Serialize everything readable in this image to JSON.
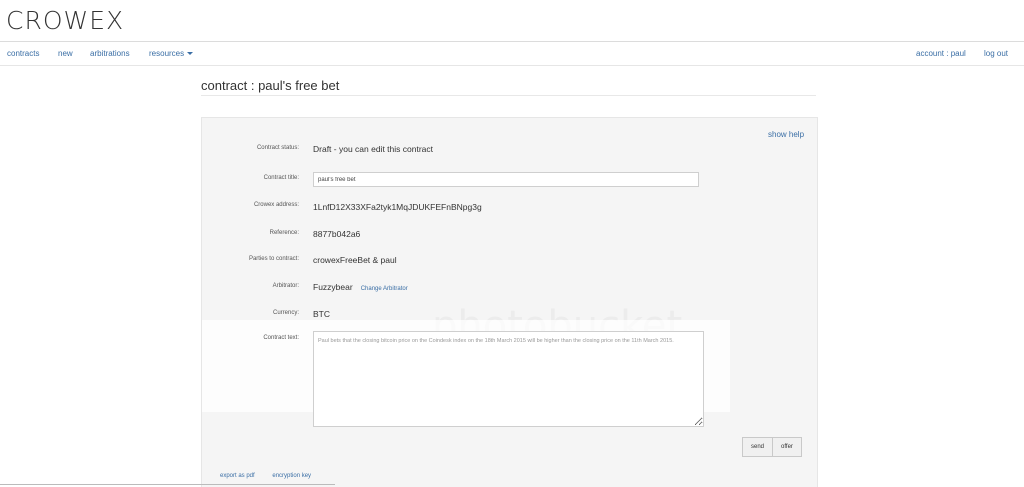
{
  "brand": "CROWEX",
  "nav": {
    "left": [
      "contracts",
      "new",
      "arbitrations",
      "resources"
    ],
    "account": "account : paul",
    "logout": "log out"
  },
  "page_title": "contract : paul's free bet",
  "help_link": "show help",
  "fields": {
    "status_label": "Contract status:",
    "status_value": "Draft - you can edit this contract",
    "title_label": "Contract title:",
    "title_value": "paul's free bet",
    "address_label": "Crowex address:",
    "address_value": "1LnfD12X33XFa2tyk1MqJDUKFEFnBNpg3g",
    "reference_label": "Reference:",
    "reference_value": "8877b042a6",
    "parties_label": "Parties to contract:",
    "parties_value": "crowexFreeBet & paul",
    "arbitrator_label": "Arbitrator:",
    "arbitrator_value": "Fuzzybear",
    "change_arbitrator": "Change Arbitrator",
    "currency_label": "Currency:",
    "currency_value": "BTC",
    "text_label": "Contract text:",
    "text_value": "Paul bets that the closing bitcoin price on the Coindesk index on the 18th March 2015 will be higher than the closing price on the 11th March 2015."
  },
  "buttons": {
    "send": "send",
    "offer": "offer"
  },
  "footer": {
    "export": "export as pdf",
    "encryption": "encryption key"
  },
  "watermark_text": "photobucket"
}
